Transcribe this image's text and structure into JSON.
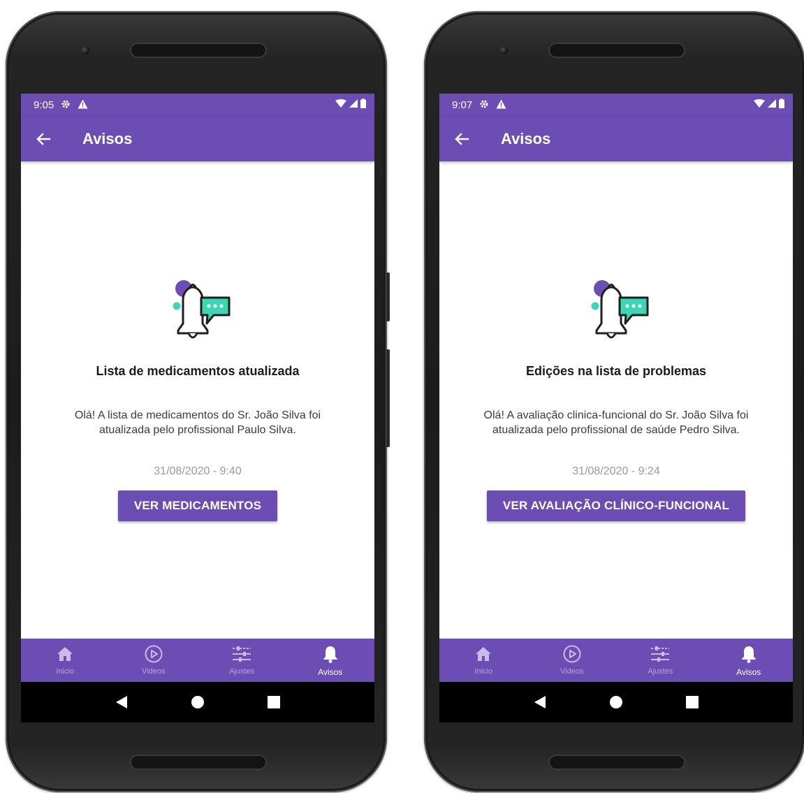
{
  "screens": [
    {
      "status_bar": {
        "time": "9:05"
      },
      "app_bar": {
        "title": "Avisos"
      },
      "notice": {
        "title": "Lista de medicamentos atualizada",
        "message": "Olá! A lista de medicamentos do  Sr. João Silva foi atualizada pelo profissional Paulo Silva.",
        "date": "31/08/2020 - 9:40",
        "button_label": "VER MEDICAMENTOS"
      },
      "bottom_nav": [
        {
          "label": "Inicio",
          "icon": "home-icon",
          "active": false
        },
        {
          "label": "Videos",
          "icon": "play-circle-icon",
          "active": false
        },
        {
          "label": "Ajustes",
          "icon": "sliders-icon",
          "active": false
        },
        {
          "label": "Avisos",
          "icon": "bell-icon",
          "active": true
        }
      ]
    },
    {
      "status_bar": {
        "time": "9:07"
      },
      "app_bar": {
        "title": "Avisos"
      },
      "notice": {
        "title": "Edições na lista de problemas",
        "message": "Olá! A avaliação clinica-funcional do  Sr. João Silva foi atualizada pelo profissional de saúde Pedro Silva.",
        "date": "31/08/2020 - 9:24",
        "button_label": "VER AVALIAÇÃO CLÍNICO-FUNCIONAL"
      },
      "bottom_nav": [
        {
          "label": "Inicio",
          "icon": "home-icon",
          "active": false
        },
        {
          "label": "Videos",
          "icon": "play-circle-icon",
          "active": false
        },
        {
          "label": "Ajustes",
          "icon": "sliders-icon",
          "active": false
        },
        {
          "label": "Avisos",
          "icon": "bell-icon",
          "active": true
        }
      ]
    }
  ],
  "colors": {
    "primary": "#6b4db3",
    "accent_teal": "#3dd6b5",
    "accent_purple": "#6b4db3",
    "inactive_nav_label": "#b6a3e0",
    "date_text": "#9a9a9a"
  },
  "icons": {
    "status": [
      "settings-icon",
      "warning-icon",
      "wifi-icon",
      "signal-icon",
      "battery-icon"
    ],
    "app_bar": "back-arrow-icon",
    "illustration": "bell-chat-illustration",
    "system_nav": [
      "back-triangle-icon",
      "home-circle-icon",
      "recents-square-icon"
    ]
  }
}
